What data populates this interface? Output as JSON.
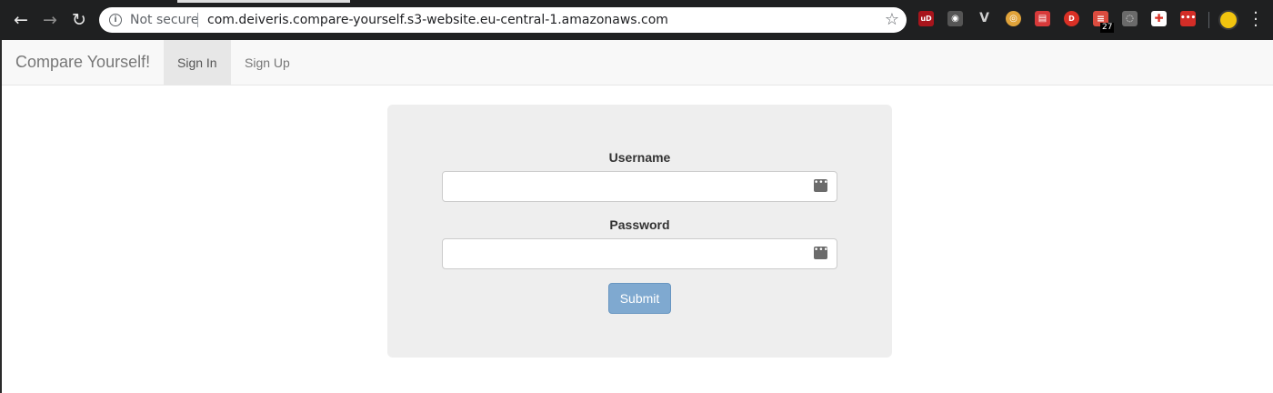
{
  "browser": {
    "security_label": "Not secure",
    "url": "com.deiveris.compare-yourself.s3-website.eu-central-1.amazonaws.com",
    "extension_badge_count": "27",
    "extensions": [
      {
        "name": "ublock-icon",
        "color": "#a8151c",
        "glyph": "uD"
      },
      {
        "name": "camera-icon",
        "color": "#2b2b2b",
        "glyph": "◉"
      },
      {
        "name": "vimium-icon",
        "color": "#1f2021",
        "glyph": "V"
      },
      {
        "name": "owl-icon",
        "color": "#2b2b2b",
        "glyph": "◎"
      },
      {
        "name": "calendar-icon",
        "color": "#d73a3a",
        "glyph": "▤"
      },
      {
        "name": "d-extension-icon",
        "color": "#d93025",
        "glyph": "D"
      },
      {
        "name": "todoist-icon",
        "color": "#db4c3f",
        "glyph": "≡"
      },
      {
        "name": "lightbulb-icon",
        "color": "#5a5a5a",
        "glyph": "◌"
      },
      {
        "name": "medical-cross-icon",
        "color": "#ffffff",
        "glyph": "✚"
      },
      {
        "name": "lastpass-icon",
        "color": "#d32d27",
        "glyph": "•••"
      }
    ]
  },
  "navbar": {
    "brand": "Compare Yourself!",
    "items": [
      {
        "label": "Sign In",
        "active": true
      },
      {
        "label": "Sign Up",
        "active": false
      }
    ]
  },
  "form": {
    "username_label": "Username",
    "username_value": "",
    "password_label": "Password",
    "password_value": "",
    "submit_label": "Submit"
  }
}
